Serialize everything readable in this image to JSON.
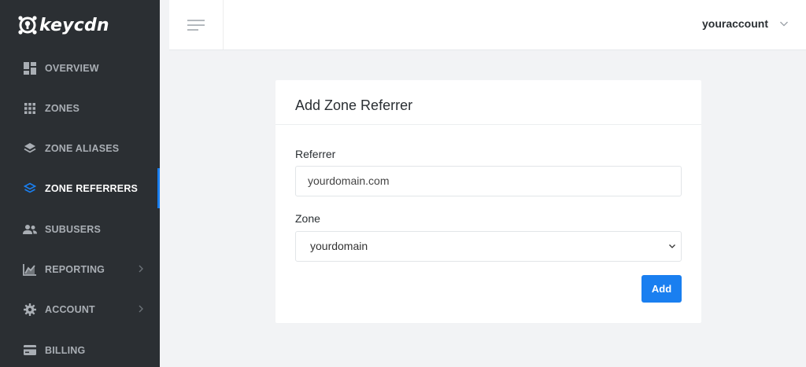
{
  "brand": {
    "name": "keycdn",
    "accent": "#1a7ff0",
    "sidebar_bg": "#2b2f33"
  },
  "sidebar": {
    "items": [
      {
        "label": "OVERVIEW",
        "icon": "dashboard-icon",
        "active": false,
        "has_submenu": false
      },
      {
        "label": "ZONES",
        "icon": "grid-icon",
        "active": false,
        "has_submenu": false
      },
      {
        "label": "ZONE ALIASES",
        "icon": "layers-icon",
        "active": false,
        "has_submenu": false
      },
      {
        "label": "ZONE REFERRERS",
        "icon": "layers-outline-icon",
        "active": true,
        "has_submenu": false
      },
      {
        "label": "SUBUSERS",
        "icon": "users-icon",
        "active": false,
        "has_submenu": false
      },
      {
        "label": "REPORTING",
        "icon": "chart-icon",
        "active": false,
        "has_submenu": true
      },
      {
        "label": "ACCOUNT",
        "icon": "gear-icon",
        "active": false,
        "has_submenu": true
      },
      {
        "label": "BILLING",
        "icon": "credit-card-icon",
        "active": false,
        "has_submenu": false
      }
    ]
  },
  "header": {
    "account_name": "youraccount",
    "menu_icon": "hamburger-icon"
  },
  "form": {
    "title": "Add Zone Referrer",
    "referrer_label": "Referrer",
    "referrer_value": "yourdomain.com",
    "zone_label": "Zone",
    "zone_selected": "yourdomain",
    "submit_label": "Add"
  }
}
